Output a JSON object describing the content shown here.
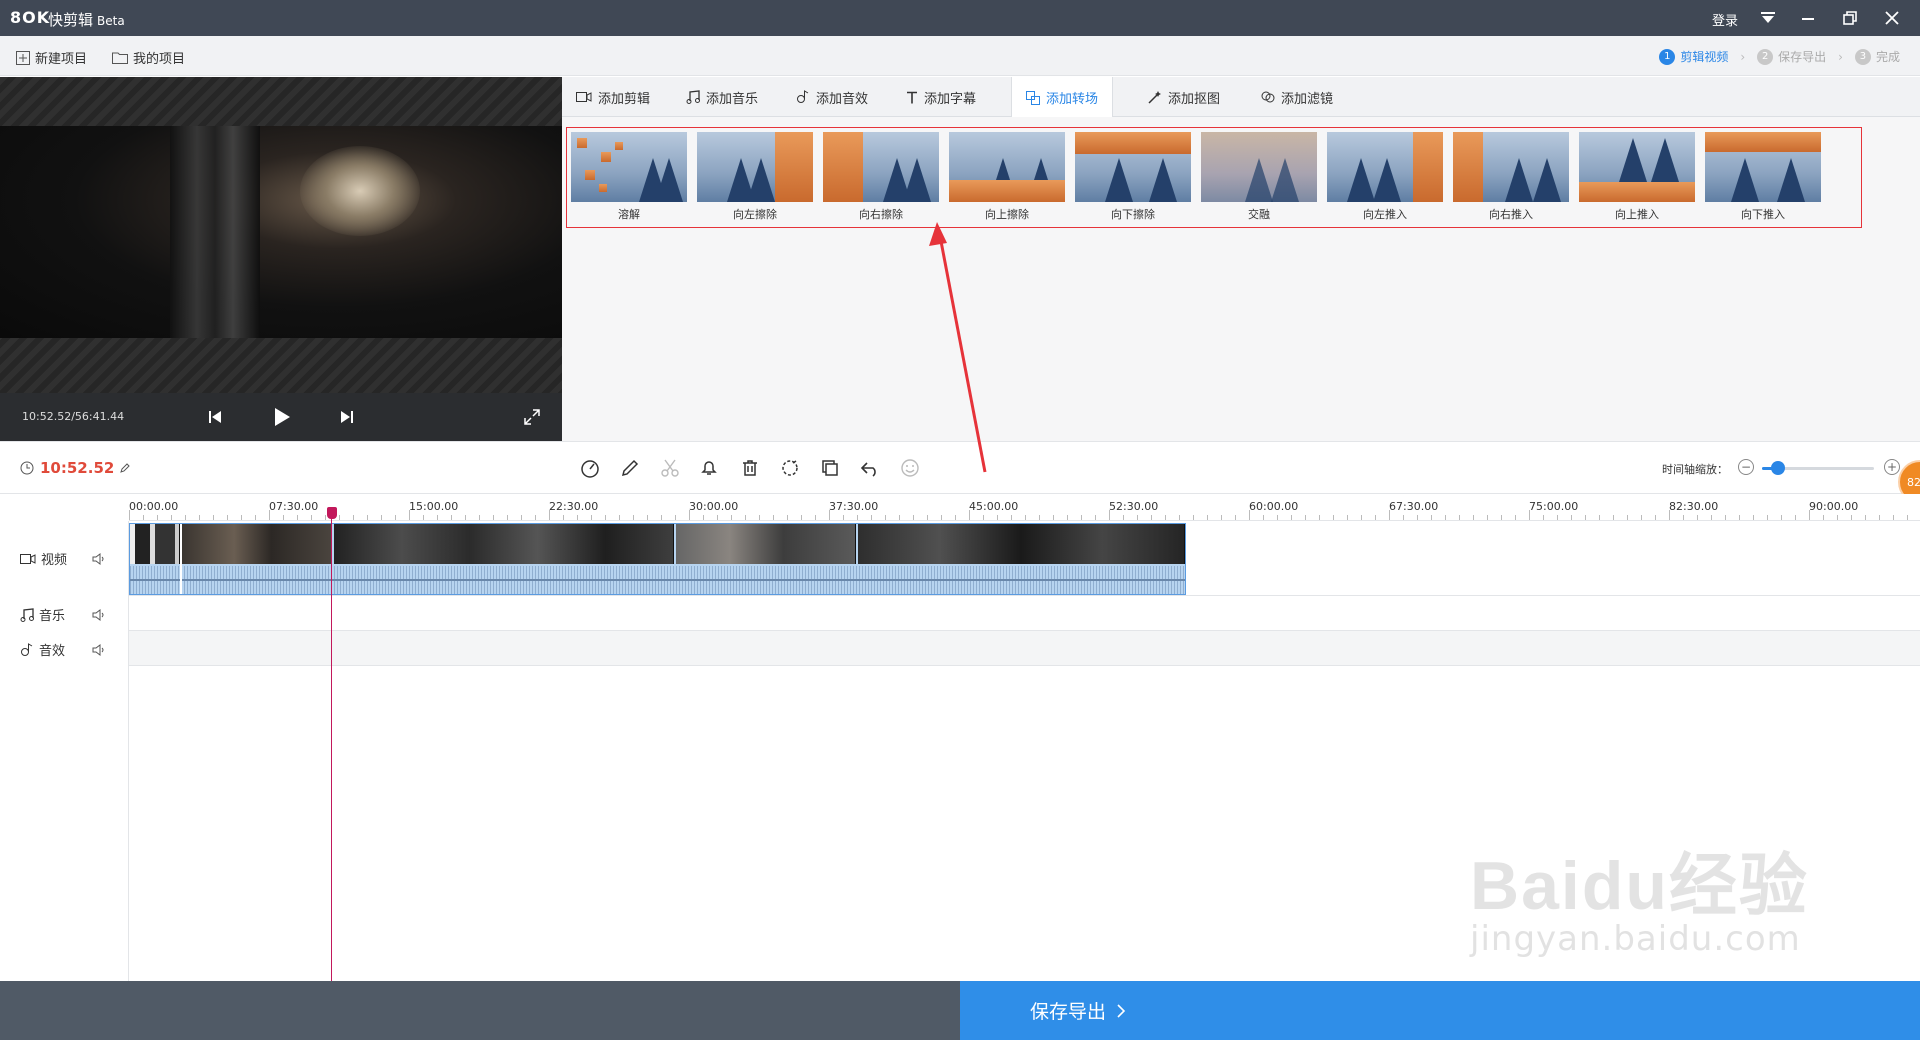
{
  "app": {
    "logo": "8OK",
    "title": "快剪辑",
    "title_suffix": "Beta",
    "login_label": "登录"
  },
  "menu": {
    "new_project": "新建项目",
    "my_projects": "我的项目"
  },
  "steps": [
    {
      "num": "1",
      "label": "剪辑视频",
      "active": true
    },
    {
      "num": "2",
      "label": "保存导出",
      "active": false
    },
    {
      "num": "3",
      "label": "完成",
      "active": false
    }
  ],
  "player": {
    "time_display": "10:52.52/56:41.44"
  },
  "tabs": [
    {
      "label": "添加剪辑",
      "icon": "video-camera-icon"
    },
    {
      "label": "添加音乐",
      "icon": "music-note-icon"
    },
    {
      "label": "添加音效",
      "icon": "sound-effect-icon"
    },
    {
      "label": "添加字幕",
      "icon": "text-icon"
    },
    {
      "label": "添加转场",
      "icon": "transition-icon",
      "active": true
    },
    {
      "label": "添加抠图",
      "icon": "magic-wand-icon"
    },
    {
      "label": "添加滤镜",
      "icon": "filter-icon"
    }
  ],
  "transitions": [
    {
      "label": "溶解"
    },
    {
      "label": "向左擦除"
    },
    {
      "label": "向右擦除"
    },
    {
      "label": "向上擦除"
    },
    {
      "label": "向下擦除"
    },
    {
      "label": "交融"
    },
    {
      "label": "向左推入"
    },
    {
      "label": "向右推入"
    },
    {
      "label": "向上推入"
    },
    {
      "label": "向下推入"
    }
  ],
  "timeline": {
    "current_time": "10:52.52",
    "zoom_label": "时间轴缩放：",
    "zoom_value": 0.15,
    "badge_text": "82",
    "ruler": [
      "00:00.00",
      "07:30.00",
      "15:00.00",
      "22:30.00",
      "30:00.00",
      "37:30.00",
      "45:00.00",
      "52:30.00",
      "60:00.00",
      "67:30.00",
      "75:00.00",
      "82:30.00",
      "90:00.00"
    ],
    "tracks": {
      "video": "视频",
      "music": "音乐",
      "effects": "音效"
    }
  },
  "footer": {
    "export_label": "保存导出"
  },
  "watermark": {
    "brand": "Bai",
    "brand_mid": "du",
    "brand_cn": "经验",
    "url": "jingyan.baidu.com"
  },
  "colors": {
    "accent": "#2a86e6",
    "titlebar": "#404855",
    "time_red": "#e04a3a",
    "highlight_red": "#e6333a"
  }
}
